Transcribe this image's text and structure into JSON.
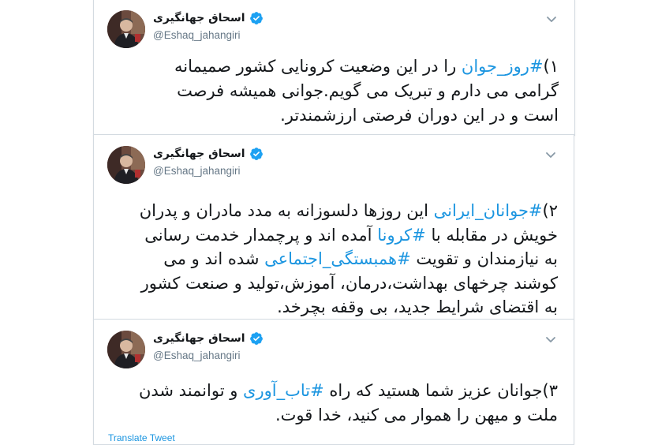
{
  "author": {
    "name": "اسحاق جهانگیری",
    "handle": "@Eshaq_jahangiri"
  },
  "tweets": [
    {
      "lines": [
        [
          {
            "t": "۱)"
          },
          {
            "t": "#روز_جوان",
            "hl": true
          },
          {
            "t": " را در این وضعیت کرونایی کشور صمیمانه"
          }
        ],
        [
          {
            "t": "گرامی می دارم و تبریک می گویم.جوانی همیشه فرصت"
          }
        ],
        [
          {
            "t": "است و در این دوران فرصتی ارزشمندتر."
          }
        ]
      ]
    },
    {
      "lines": [
        [
          {
            "t": "۲)"
          },
          {
            "t": "#جوانان_ایرانی",
            "hl": true
          },
          {
            "t": " این روزها دلسوزانه به مدد مادران و پدران"
          }
        ],
        [
          {
            "t": "خویش در مقابله با "
          },
          {
            "t": "#کرونا",
            "hl": true
          },
          {
            "t": " آمده اند و پرچمدار خدمت رسانی"
          }
        ],
        [
          {
            "t": "به نیازمندان و تقویت "
          },
          {
            "t": "#همبستگی_اجتماعی",
            "hl": true
          },
          {
            "t": " شده اند و می"
          }
        ],
        [
          {
            "t": "کوشند چرخهای بهداشت،درمان، آموزش،تولید و صنعت کشور"
          }
        ],
        [
          {
            "t": "به اقتضای شرایط جدید، بی وقفه بچرخد."
          }
        ]
      ]
    },
    {
      "lines": [
        [
          {
            "t": "۳)جوانان عزیز شما هستید که راه "
          },
          {
            "t": "#تاب_آوری",
            "hl": true
          },
          {
            "t": " و توانمند شدن"
          }
        ],
        [
          {
            "t": "ملت و میهن را هموار می کنید، خدا قوت."
          }
        ]
      ],
      "translate_label": "Translate Tweet"
    }
  ],
  "colors": {
    "link": "#1b95e0",
    "verified": "#1da1f2",
    "border": "#d4dbe1"
  },
  "icons": {
    "verified": "verified-badge-icon",
    "menu": "chevron-down-icon"
  }
}
